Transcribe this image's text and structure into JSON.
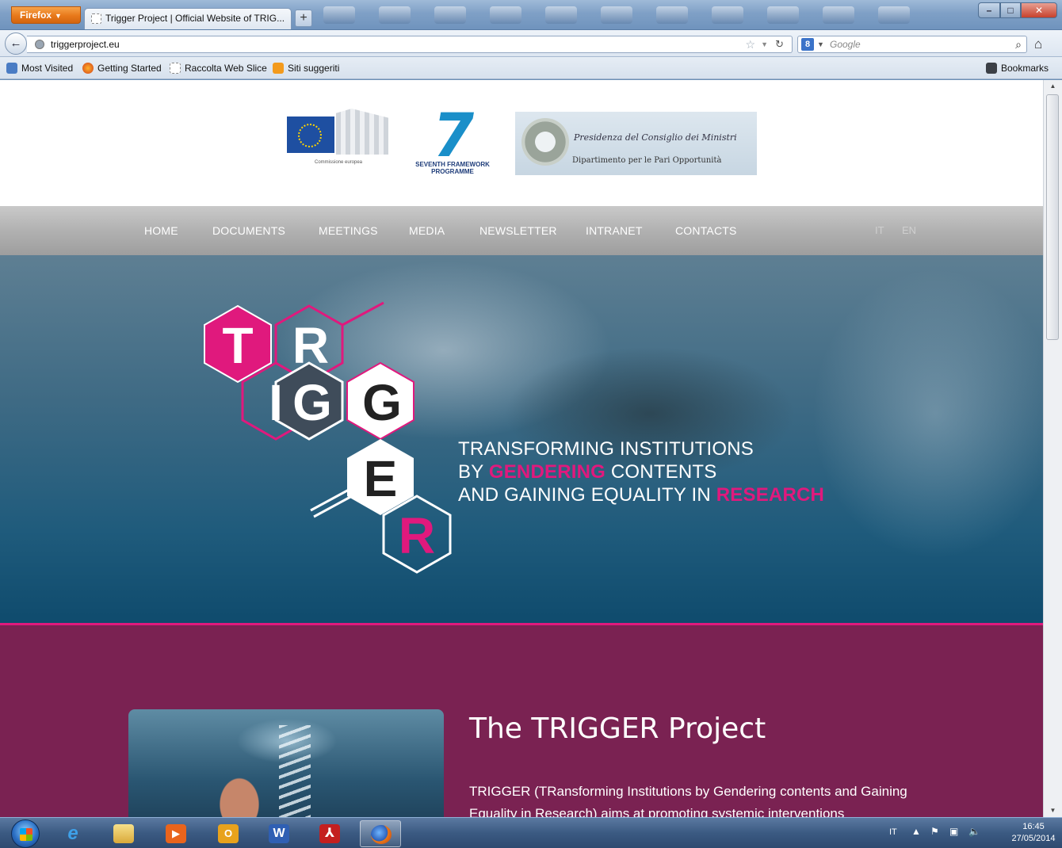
{
  "browser": {
    "app_button": "Firefox",
    "tab_title": "Trigger Project | Official Website of TRIG...",
    "new_tab": "+",
    "url": "triggerproject.eu",
    "search_placeholder": "Google",
    "bookmarks": [
      {
        "label": "Most Visited",
        "icon": "most-visited-icon"
      },
      {
        "label": "Getting Started",
        "icon": "firefox-icon"
      },
      {
        "label": "Raccolta Web Slice",
        "icon": "web-slice-icon"
      },
      {
        "label": "Siti suggeriti",
        "icon": "suggested-sites-icon"
      }
    ],
    "bookmarks_menu": "Bookmarks"
  },
  "page": {
    "logos": {
      "eu_caption": "Commissione europea",
      "fp7_caption": "SEVENTH FRAMEWORK PROGRAMME",
      "gov_line1": "Presidenza del Consiglio dei Ministri",
      "gov_line2": "Dipartimento per le Pari Opportunità"
    },
    "menu": [
      "HOME",
      "DOCUMENTS",
      "MEETINGS",
      "MEDIA",
      "NEWSLETTER",
      "INTRANET",
      "CONTACTS"
    ],
    "languages": [
      "IT",
      "EN"
    ],
    "hero": {
      "logo_letters": [
        "T",
        "R",
        "I",
        "G",
        "G",
        "E",
        "R"
      ],
      "tagline_line1": "TRANSFORMING INSTITUTIONS",
      "tagline_by": "BY ",
      "tagline_gendering": "GENDERING",
      "tagline_contents": " CONTENTS",
      "tagline_line3": "AND GAINING EQUALITY IN ",
      "tagline_research": "RESEARCH"
    },
    "about": {
      "title": "The TRIGGER Project",
      "text": "TRIGGER (TRansforming Institutions by Gendering contents and Gaining Equality in Research) aims at promoting systemic interventions"
    }
  },
  "taskbar": {
    "apps": [
      "internet-explorer-icon",
      "file-explorer-icon",
      "media-player-icon",
      "outlook-icon",
      "word-icon",
      "acrobat-icon",
      "firefox-icon"
    ],
    "lang": "IT",
    "time": "16:45",
    "date": "27/05/2014"
  },
  "colors": {
    "accent_pink": "#e0197d",
    "content_bg": "#7a2252",
    "menu_gray": "#b1b1b1"
  }
}
